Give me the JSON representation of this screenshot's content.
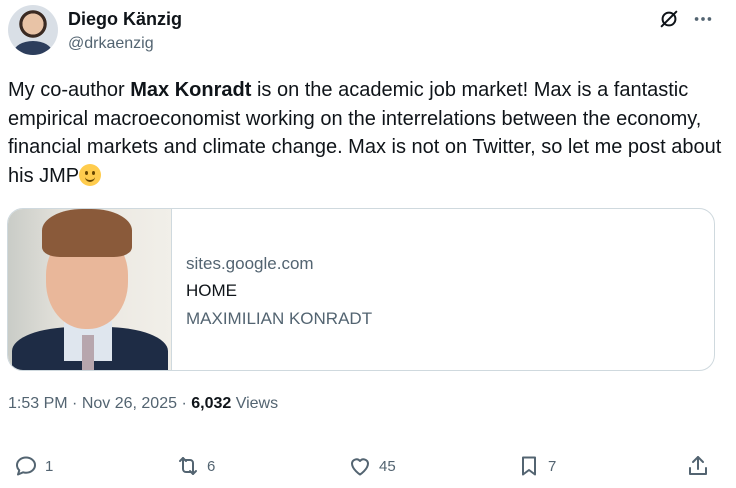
{
  "author": {
    "name": "Diego Känzig",
    "handle": "@drkaenzig"
  },
  "tweet": {
    "text_before": "My co-author ",
    "text_bold": "Max Konradt",
    "text_after": " is on the academic job market! Max is a fantastic empirical macroeconomist working on the interrelations between the economy, financial markets and climate change. Max is not on Twitter, so let me post about his JMP"
  },
  "card": {
    "domain": "sites.google.com",
    "title": "HOME",
    "description": "MAXIMILIAN KONRADT"
  },
  "meta": {
    "time": "1:53 PM",
    "separator1": " · ",
    "date": "Nov 26, 2025",
    "separator2": " · ",
    "views_count": "6,032",
    "views_label": " Views"
  },
  "actions": {
    "reply_count": "1",
    "retweet_count": "6",
    "like_count": "45",
    "bookmark_count": "7"
  },
  "icons": {
    "header": [
      "grok-icon",
      "more-icon"
    ],
    "actions": [
      "reply-icon",
      "retweet-icon",
      "like-icon",
      "bookmark-icon",
      "share-icon"
    ]
  },
  "colors": {
    "text": "#0f1419",
    "secondary": "#536471",
    "border": "#cfd9de"
  }
}
